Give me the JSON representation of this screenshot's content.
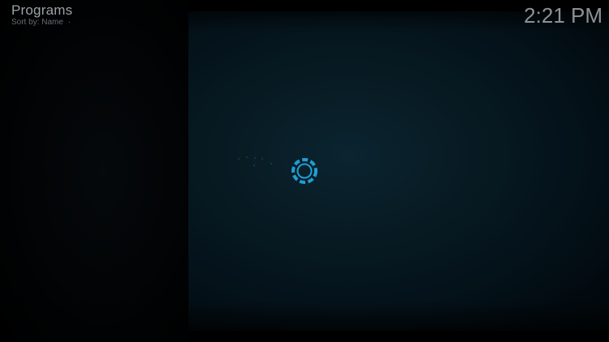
{
  "header": {
    "title": "Programs",
    "sort_label": "Sort by: Name",
    "sort_suffix": "·"
  },
  "clock": {
    "time": "2:21 PM"
  },
  "loading": {
    "icon": "busy-spinner-icon",
    "accent_color": "#1f9fd4"
  },
  "colors": {
    "background": "#000000",
    "content_panel": "#0b2430",
    "title_text": "#9aa3a8",
    "subtitle_text": "#656c71",
    "clock_text": "#8b9297"
  }
}
